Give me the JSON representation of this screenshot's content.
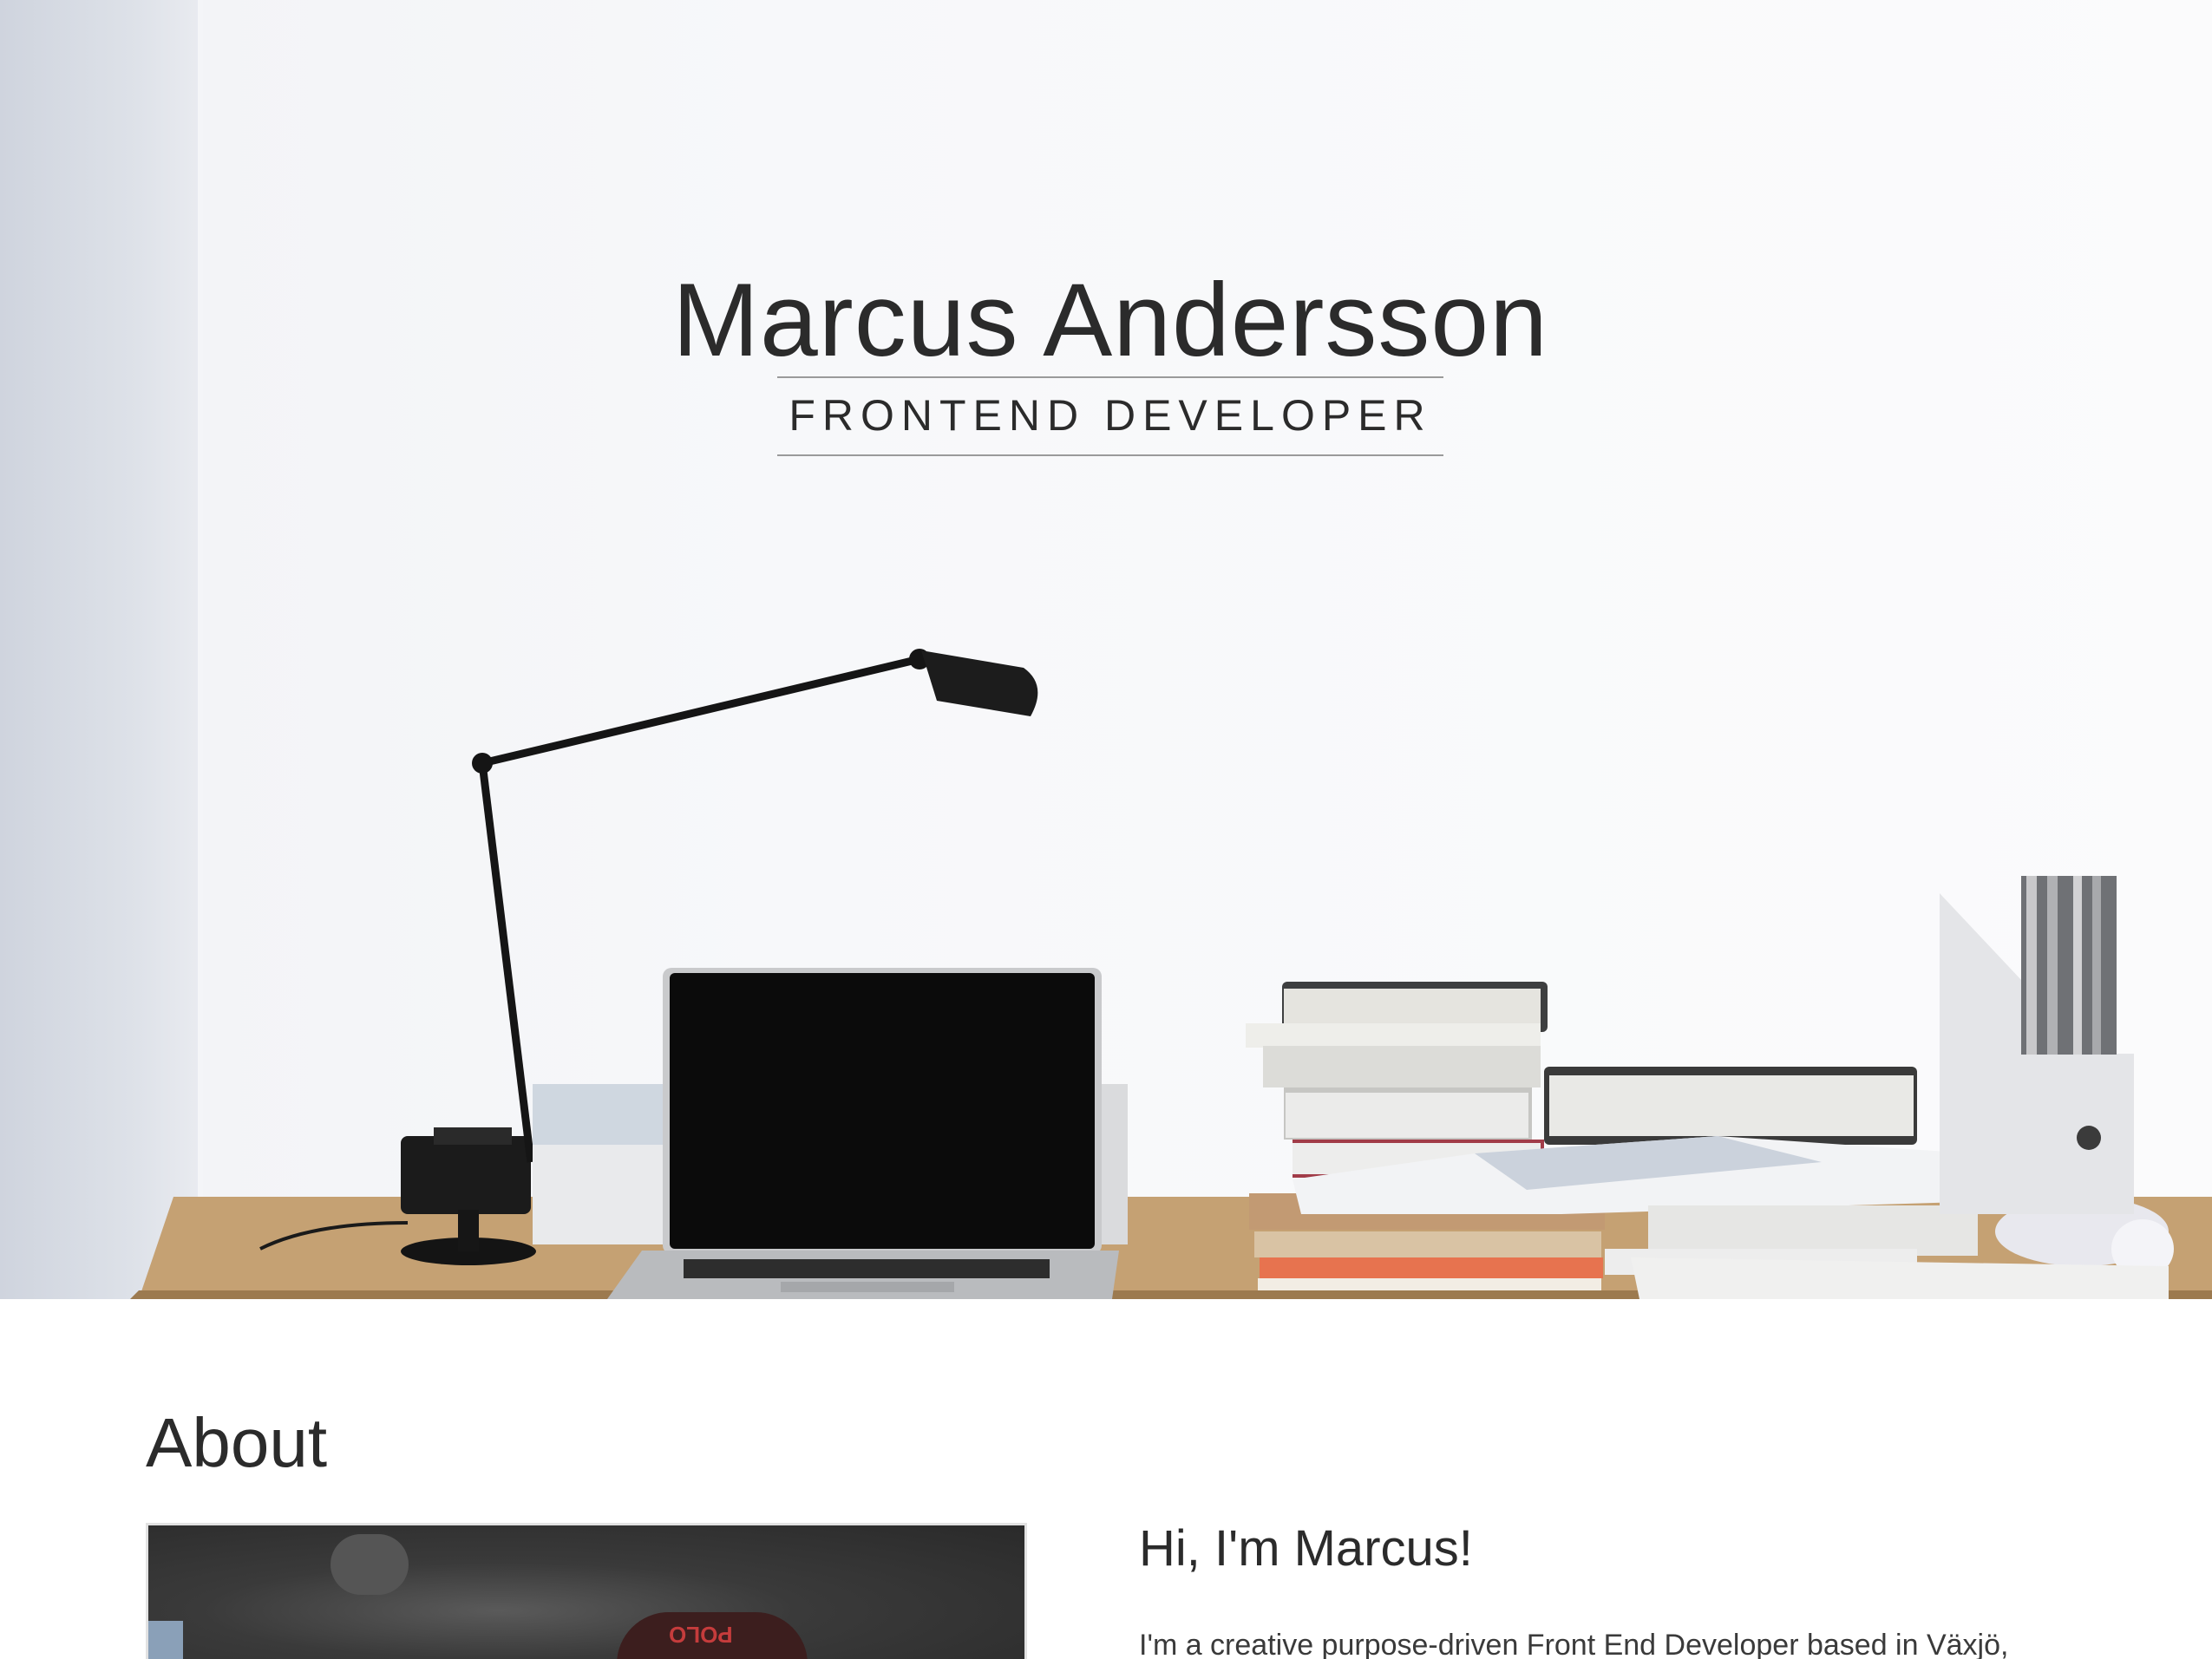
{
  "hero": {
    "title": "Marcus Andersson",
    "subtitle": "FRONTEND DEVELOPER"
  },
  "about": {
    "heading": "About",
    "photo_badge": "POLO",
    "greeting": "Hi, I'm Marcus!",
    "intro": "I'm a creative purpose-driven Front End Developer based in Växjö,"
  },
  "colors": {
    "text": "#2b2b2b",
    "rule": "#9a9a9a",
    "background": "#ffffff"
  }
}
